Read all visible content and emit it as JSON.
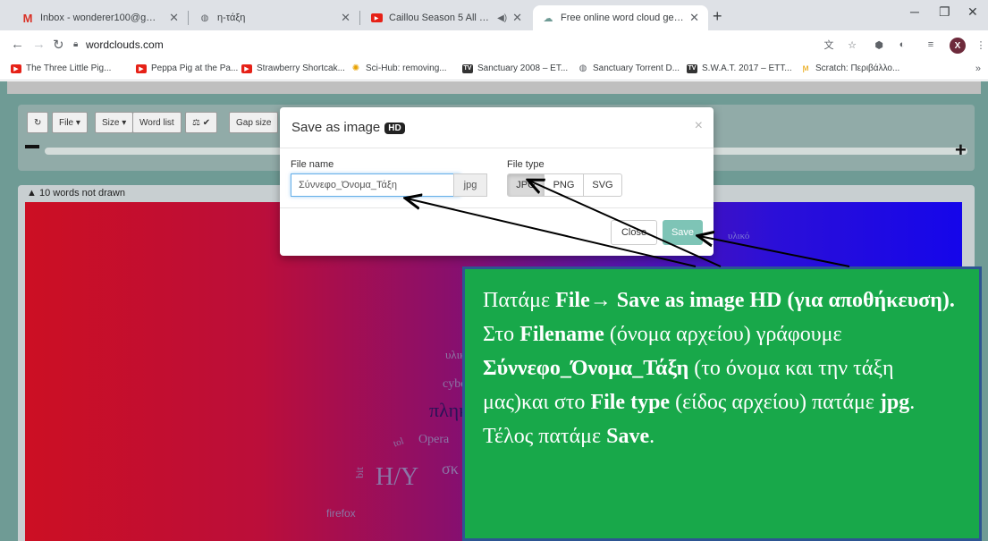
{
  "browser": {
    "tabs": [
      {
        "title": "Inbox - wonderer100@gmail.com",
        "icon": "gmail-icon",
        "active": false
      },
      {
        "title": "η-τάξη",
        "icon": "globe-icon",
        "active": false
      },
      {
        "title": "Caillou Season 5 All Episodes",
        "icon": "youtube-icon",
        "active": false
      },
      {
        "title": "Free online word cloud generator",
        "icon": "wordclouds-icon",
        "active": true
      }
    ],
    "url": "wordclouds.com",
    "profile_initial": "X",
    "bookmarks": [
      {
        "label": "The Three Little Pig...",
        "icon": "youtube-icon"
      },
      {
        "label": "Peppa Pig at the Pa...",
        "icon": "youtube-icon"
      },
      {
        "label": "Strawberry Shortcak...",
        "icon": "youtube-icon"
      },
      {
        "label": "Sci-Hub: removing...",
        "icon": "scihub-icon"
      },
      {
        "label": "Sanctuary 2008 – ET...",
        "icon": "tv-icon"
      },
      {
        "label": "Sanctuary Torrent D...",
        "icon": "globe-icon"
      },
      {
        "label": "S.W.A.T. 2017 – ETT...",
        "icon": "tv-icon"
      },
      {
        "label": "Scratch: Περιβάλλο...",
        "icon": "scratch-icon"
      }
    ]
  },
  "toolbar": {
    "file_label": "File ▾",
    "size_label": "Size ▾",
    "word_list_label": "Word list",
    "gap_size_label": "Gap size"
  },
  "cloud": {
    "warning": "10 words not drawn",
    "words": [
      "υλικό",
      "cyber",
      "πληκ",
      "Opera",
      "tol",
      "bit",
      "H/Y",
      "σκ",
      "firefox",
      "υλικό"
    ]
  },
  "modal": {
    "title": "Save as image",
    "badge": "HD",
    "close_symbol": "×",
    "file_name_label": "File name",
    "file_name_value": "Σύννεφο_Όνομα_Τάξη",
    "file_ext": "jpg",
    "file_type_label": "File type",
    "file_types": [
      "JPG",
      "PNG",
      "SVG"
    ],
    "selected_file_type": "JPG",
    "close_button": "Close",
    "save_button": "Save"
  },
  "instruction": {
    "p1": "Πατάμε ",
    "b1": "File",
    "b2": "→ Save as image HD (για αποθήκευση).",
    "p2": " Στο ",
    "b3": "Filename",
    "p3": " (όνομα αρχείου) γράφουμε ",
    "b4": "Σύννεφο_Όνομα_Τάξη",
    "p4": " (το όνομα και την τάξη μας)και στο ",
    "b5": "File type",
    "p5": " (είδος αρχείου) πατάμε ",
    "b6": "jpg",
    "p6": ". Τέλος πατάμε ",
    "b7": "Save",
    "p7": "."
  },
  "colors": {
    "page_bg": "#6f9b95",
    "callout_bg": "#18a84a",
    "callout_border": "#2d5592",
    "save_button": "#7ec4b6"
  }
}
